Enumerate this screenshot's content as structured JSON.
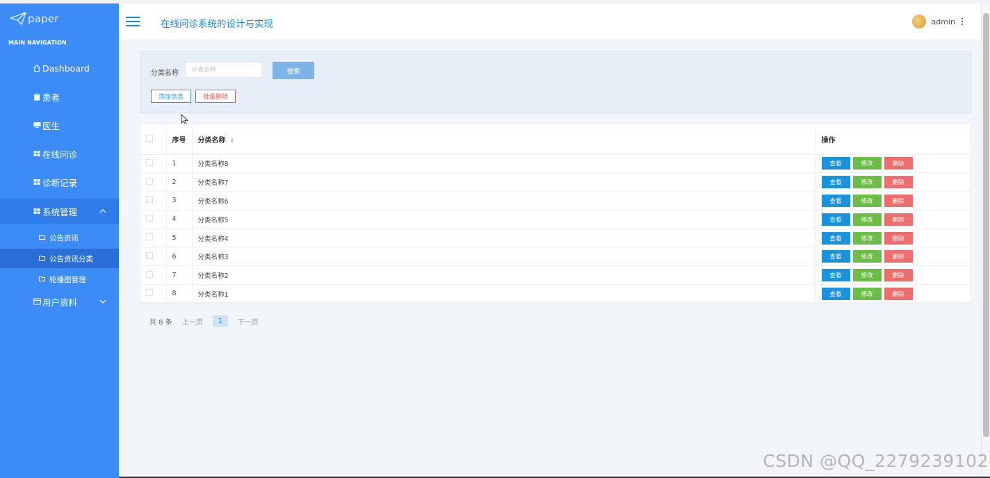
{
  "brand": {
    "name": "paper"
  },
  "sidebar": {
    "section_title": "MAIN NAVIGATION",
    "items": [
      {
        "label": "Dashboard",
        "icon": "home-icon"
      },
      {
        "label": "患者",
        "icon": "clipboard-icon"
      },
      {
        "label": "医生",
        "icon": "monitor-icon"
      },
      {
        "label": "在线问诊",
        "icon": "grid-icon"
      },
      {
        "label": "诊断记录",
        "icon": "grid-icon"
      },
      {
        "label": "系统管理",
        "icon": "grid-icon"
      }
    ],
    "sub_items": [
      {
        "label": "公告资讯",
        "icon": "folder-icon"
      },
      {
        "label": "公告资讯分类",
        "icon": "folder-icon"
      },
      {
        "label": "轮播图管理",
        "icon": "folder-icon"
      }
    ],
    "user_item": {
      "label": "用户资料",
      "icon": "card-icon"
    }
  },
  "header": {
    "title": "在线问诊系统的设计与实现",
    "username": "admin"
  },
  "search": {
    "label": "分类名称",
    "placeholder": "分类名称",
    "button": "搜索",
    "add_button": "添加信息",
    "batch_delete_button": "批量删除"
  },
  "table": {
    "headers": {
      "no": "序号",
      "name": "分类名称",
      "ops": "操作"
    },
    "rows": [
      {
        "no": "1",
        "name": "分类名称8"
      },
      {
        "no": "2",
        "name": "分类名称7"
      },
      {
        "no": "3",
        "name": "分类名称6"
      },
      {
        "no": "4",
        "name": "分类名称5"
      },
      {
        "no": "5",
        "name": "分类名称4"
      },
      {
        "no": "6",
        "name": "分类名称3"
      },
      {
        "no": "7",
        "name": "分类名称2"
      },
      {
        "no": "8",
        "name": "分类名称1"
      }
    ],
    "actions": {
      "view": "查看",
      "edit": "修改",
      "remove": "删除"
    }
  },
  "pagination": {
    "total": "共 8 条",
    "prev": "上一页",
    "current": "1",
    "next": "下一页"
  },
  "watermark": "CSDN @QQ_2279239102",
  "colors": {
    "sidebar": "#3b8cf6",
    "primary": "#1a92dc",
    "success": "#6bbd45",
    "danger": "#ee6d6d"
  }
}
